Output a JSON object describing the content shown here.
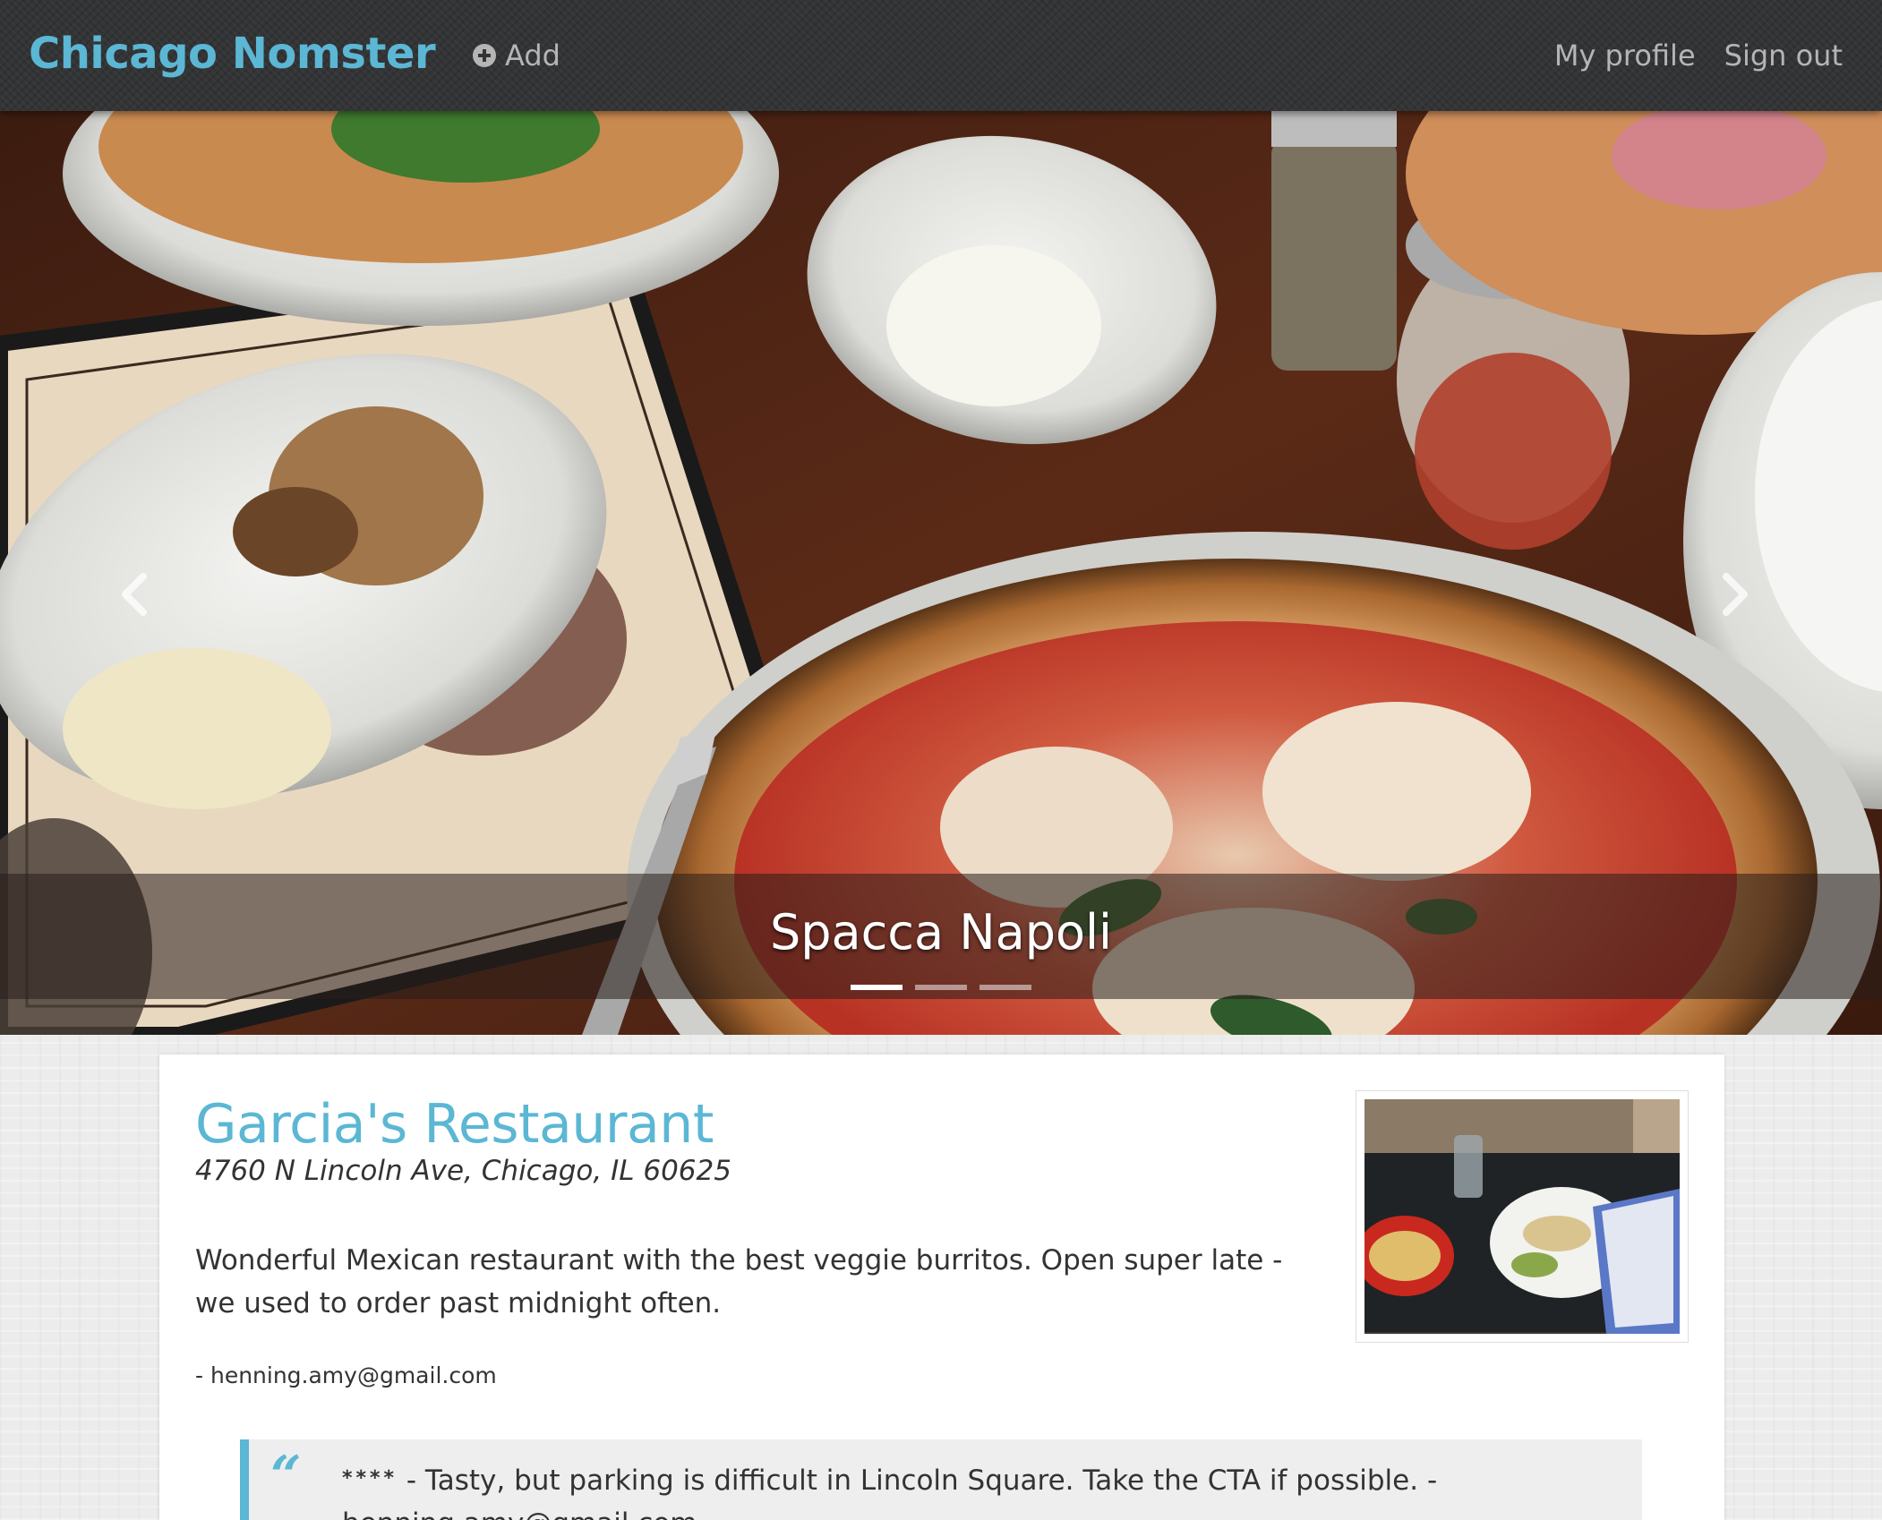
{
  "navbar": {
    "brand": "Chicago Nomster",
    "add_label": "Add",
    "add_icon": "plus-circle-icon",
    "links": [
      "My profile",
      "Sign out"
    ]
  },
  "carousel": {
    "caption": "Spacca Napoli",
    "slide_count": 3,
    "active_index": 0,
    "prev_icon": "chevron-left-icon",
    "next_icon": "chevron-right-icon"
  },
  "restaurant": {
    "name": "Garcia's Restaurant",
    "address": "4760 N Lincoln Ave, Chicago, IL 60625",
    "description": "Wonderful Mexican restaurant with the best veggie burritos. Open super late - we used to order past midnight often.",
    "author": "- henning.amy@gmail.com"
  },
  "comment": {
    "stars": "****",
    "text": " - Tasty, but parking is difficult in Lincoln Square. Take the CTA if possible. - henning.amy@gmail.com"
  },
  "colors": {
    "brand": "#5bb7d4",
    "navbar": "#333436",
    "nav_text": "#b5b5b5",
    "text": "#333333"
  }
}
